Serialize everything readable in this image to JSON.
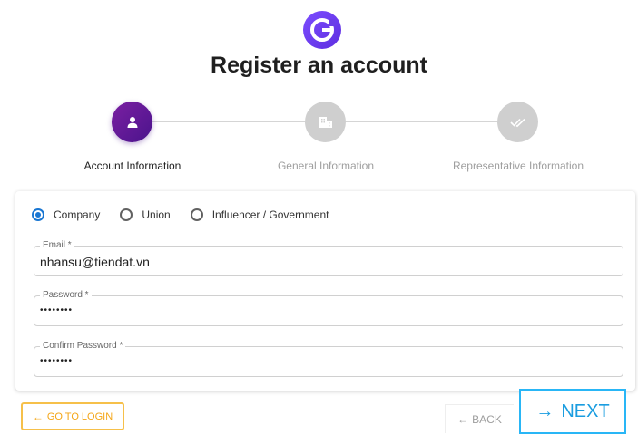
{
  "brand": {
    "logo_icon": "g-letter-icon",
    "accent": "#6a3de8"
  },
  "page": {
    "title": "Register an account"
  },
  "stepper": {
    "steps": [
      {
        "label": "Account Information",
        "icon": "user-icon",
        "state": "active"
      },
      {
        "label": "General Information",
        "icon": "building-icon",
        "state": "inactive"
      },
      {
        "label": "Representative Information",
        "icon": "double-check-icon",
        "state": "inactive"
      }
    ],
    "active_color": "#6a1b9a",
    "inactive_color": "#cfcfcf"
  },
  "account_type": {
    "options": [
      "Company",
      "Union",
      "Influencer / Government"
    ],
    "selected": "Company"
  },
  "form": {
    "email": {
      "label": "Email *",
      "value": "nhansu@tiendat.vn"
    },
    "password": {
      "label": "Password *",
      "value": "••••••••"
    },
    "confirm_password": {
      "label": "Confirm Password *",
      "value": "••••••••"
    }
  },
  "actions": {
    "go_to_login": "GO TO LOGIN",
    "back": "BACK",
    "next": "NEXT",
    "go_to_login_color": "#f6c04a",
    "next_color": "#29b6f6"
  }
}
